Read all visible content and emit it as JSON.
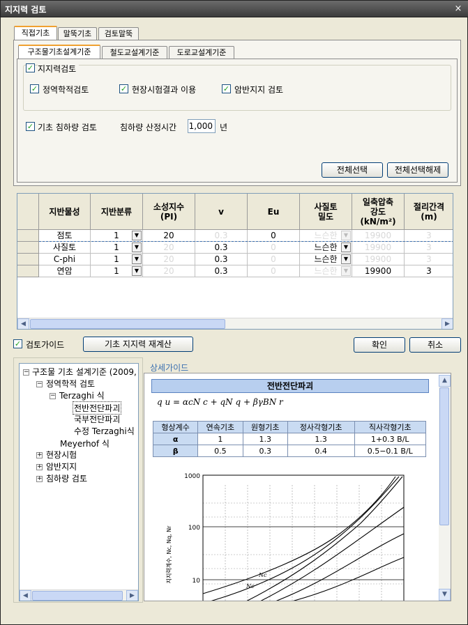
{
  "window": {
    "title": "지지력 검토",
    "close": "×"
  },
  "tabs_top": [
    "직접기초",
    "말뚝기초",
    "검토말뚝"
  ],
  "tabs_sub": [
    "구조물기초설계기준",
    "철도교설계기준",
    "도로교설계기준"
  ],
  "bearing": {
    "group_label": "지지력검토",
    "options": [
      "정역학적검토",
      "현장시험결과 이용",
      "암반지지 검토"
    ],
    "settlement_label": "기초 침하량 검토",
    "settlement_time_label": "침하량 산정시간",
    "settlement_time_value": "1,000",
    "settlement_time_unit": "년",
    "select_all": "전체선택",
    "deselect_all": "전체선택해제"
  },
  "grid": {
    "headers": [
      "지반물성",
      "지반분류",
      "소성지수\n(PI)",
      "v",
      "Eu",
      "사질토\n밀도",
      "일축압축\n강도\n(kN/m²)",
      "절리간격\n(m)"
    ],
    "rows": [
      {
        "name": "점토",
        "cls": "1",
        "pi": "20",
        "v": "0.3",
        "eu": "0",
        "density": "느슨한",
        "ucs": "19900",
        "joint": "3"
      },
      {
        "name": "사질토",
        "cls": "1",
        "pi": "20",
        "v": "0.3",
        "eu": "0",
        "density": "느슨한",
        "ucs": "19900",
        "joint": "3"
      },
      {
        "name": "C-phi",
        "cls": "1",
        "pi": "20",
        "v": "0.3",
        "eu": "0",
        "density": "느슨한",
        "ucs": "19900",
        "joint": "3"
      },
      {
        "name": "연암",
        "cls": "1",
        "pi": "20",
        "v": "0.3",
        "eu": "0",
        "density": "느슨한",
        "ucs": "19900",
        "joint": "3"
      }
    ]
  },
  "bottom": {
    "guide_label": "검토가이드",
    "recalc_button": "기초 지지력 재계산",
    "ok_button": "확인",
    "cancel_button": "취소"
  },
  "tree": {
    "root": "구조물 기초 설계기준 (2009,",
    "n1": "정역학적 검토",
    "n2": "Terzaghi 식",
    "n3": "전반전단파괴",
    "n4": "국부전단파괴",
    "n5": "수정 Terzaghi식",
    "n6": "Meyerhof 식",
    "n7": "현장시험",
    "n8": "암반지지",
    "n9": "침하량 검토"
  },
  "guide": {
    "title": "상세가이드",
    "heading": "전반전단파괴",
    "formula": "q u = αcN c + qN q + βγBN r",
    "table_headers": [
      "형상계수",
      "연속기초",
      "원형기초",
      "정사각형기초",
      "직사각형기초"
    ],
    "table_rows": [
      [
        "α",
        "1",
        "1.3",
        "1.3",
        "1+0.3 B/L"
      ],
      [
        "β",
        "0.5",
        "0.3",
        "0.4",
        "0.5−0.1 B/L"
      ]
    ],
    "chart_ylabel": "지지력계수, Nc, Nq, Nr",
    "chart_ticks": [
      "1000",
      "100",
      "10"
    ],
    "chart_labels": [
      "Nc",
      "Nc"
    ]
  },
  "colors": {
    "accent_tab": "#f0a030",
    "check": "#21a121",
    "guide_header": "#c9dbf2",
    "title_link": "#3a6fb0"
  }
}
